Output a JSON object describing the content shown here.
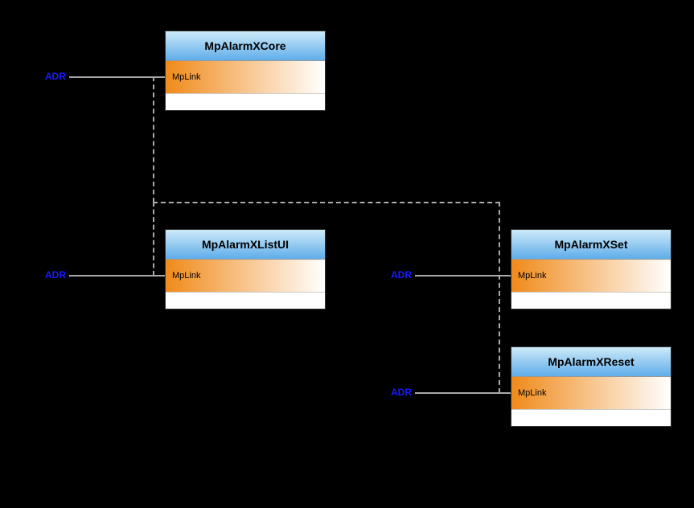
{
  "blocks": {
    "core": {
      "title": "MpAlarmXCore",
      "param": "MpLink"
    },
    "listui": {
      "title": "MpAlarmXListUI",
      "param": "MpLink"
    },
    "set": {
      "title": "MpAlarmXSet",
      "param": "MpLink"
    },
    "reset": {
      "title": "MpAlarmXReset",
      "param": "MpLink"
    }
  },
  "labels": {
    "adr1": "ADR",
    "adr2": "ADR",
    "adr3": "ADR",
    "adr4": "ADR"
  }
}
